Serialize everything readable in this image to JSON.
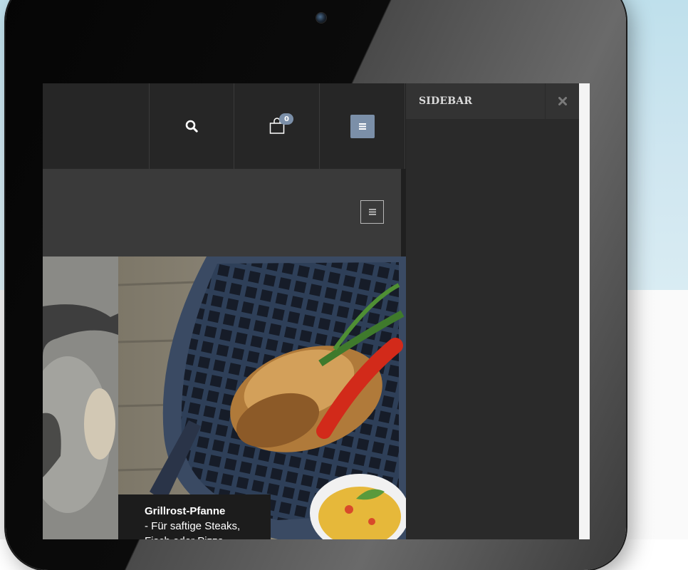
{
  "sidebar": {
    "title": "SIDEBAR",
    "close_icon": "close-icon"
  },
  "topbar": {
    "search_icon": "search-icon",
    "cart_icon": "shopping-bag-icon",
    "cart_count": "0",
    "menu_icon": "hamburger-icon"
  },
  "header": {
    "menu_icon": "hamburger-icon"
  },
  "hero": {
    "caption_title": "Grillrost-Pfanne",
    "caption_line1": "- Für saftige Steaks,",
    "caption_line2": "Fisch oder Pizza"
  },
  "colors": {
    "accent": "#7b8fa8",
    "topbar": "#262626",
    "header": "#3a3a3a",
    "sidebar": "#2a2a2a"
  }
}
